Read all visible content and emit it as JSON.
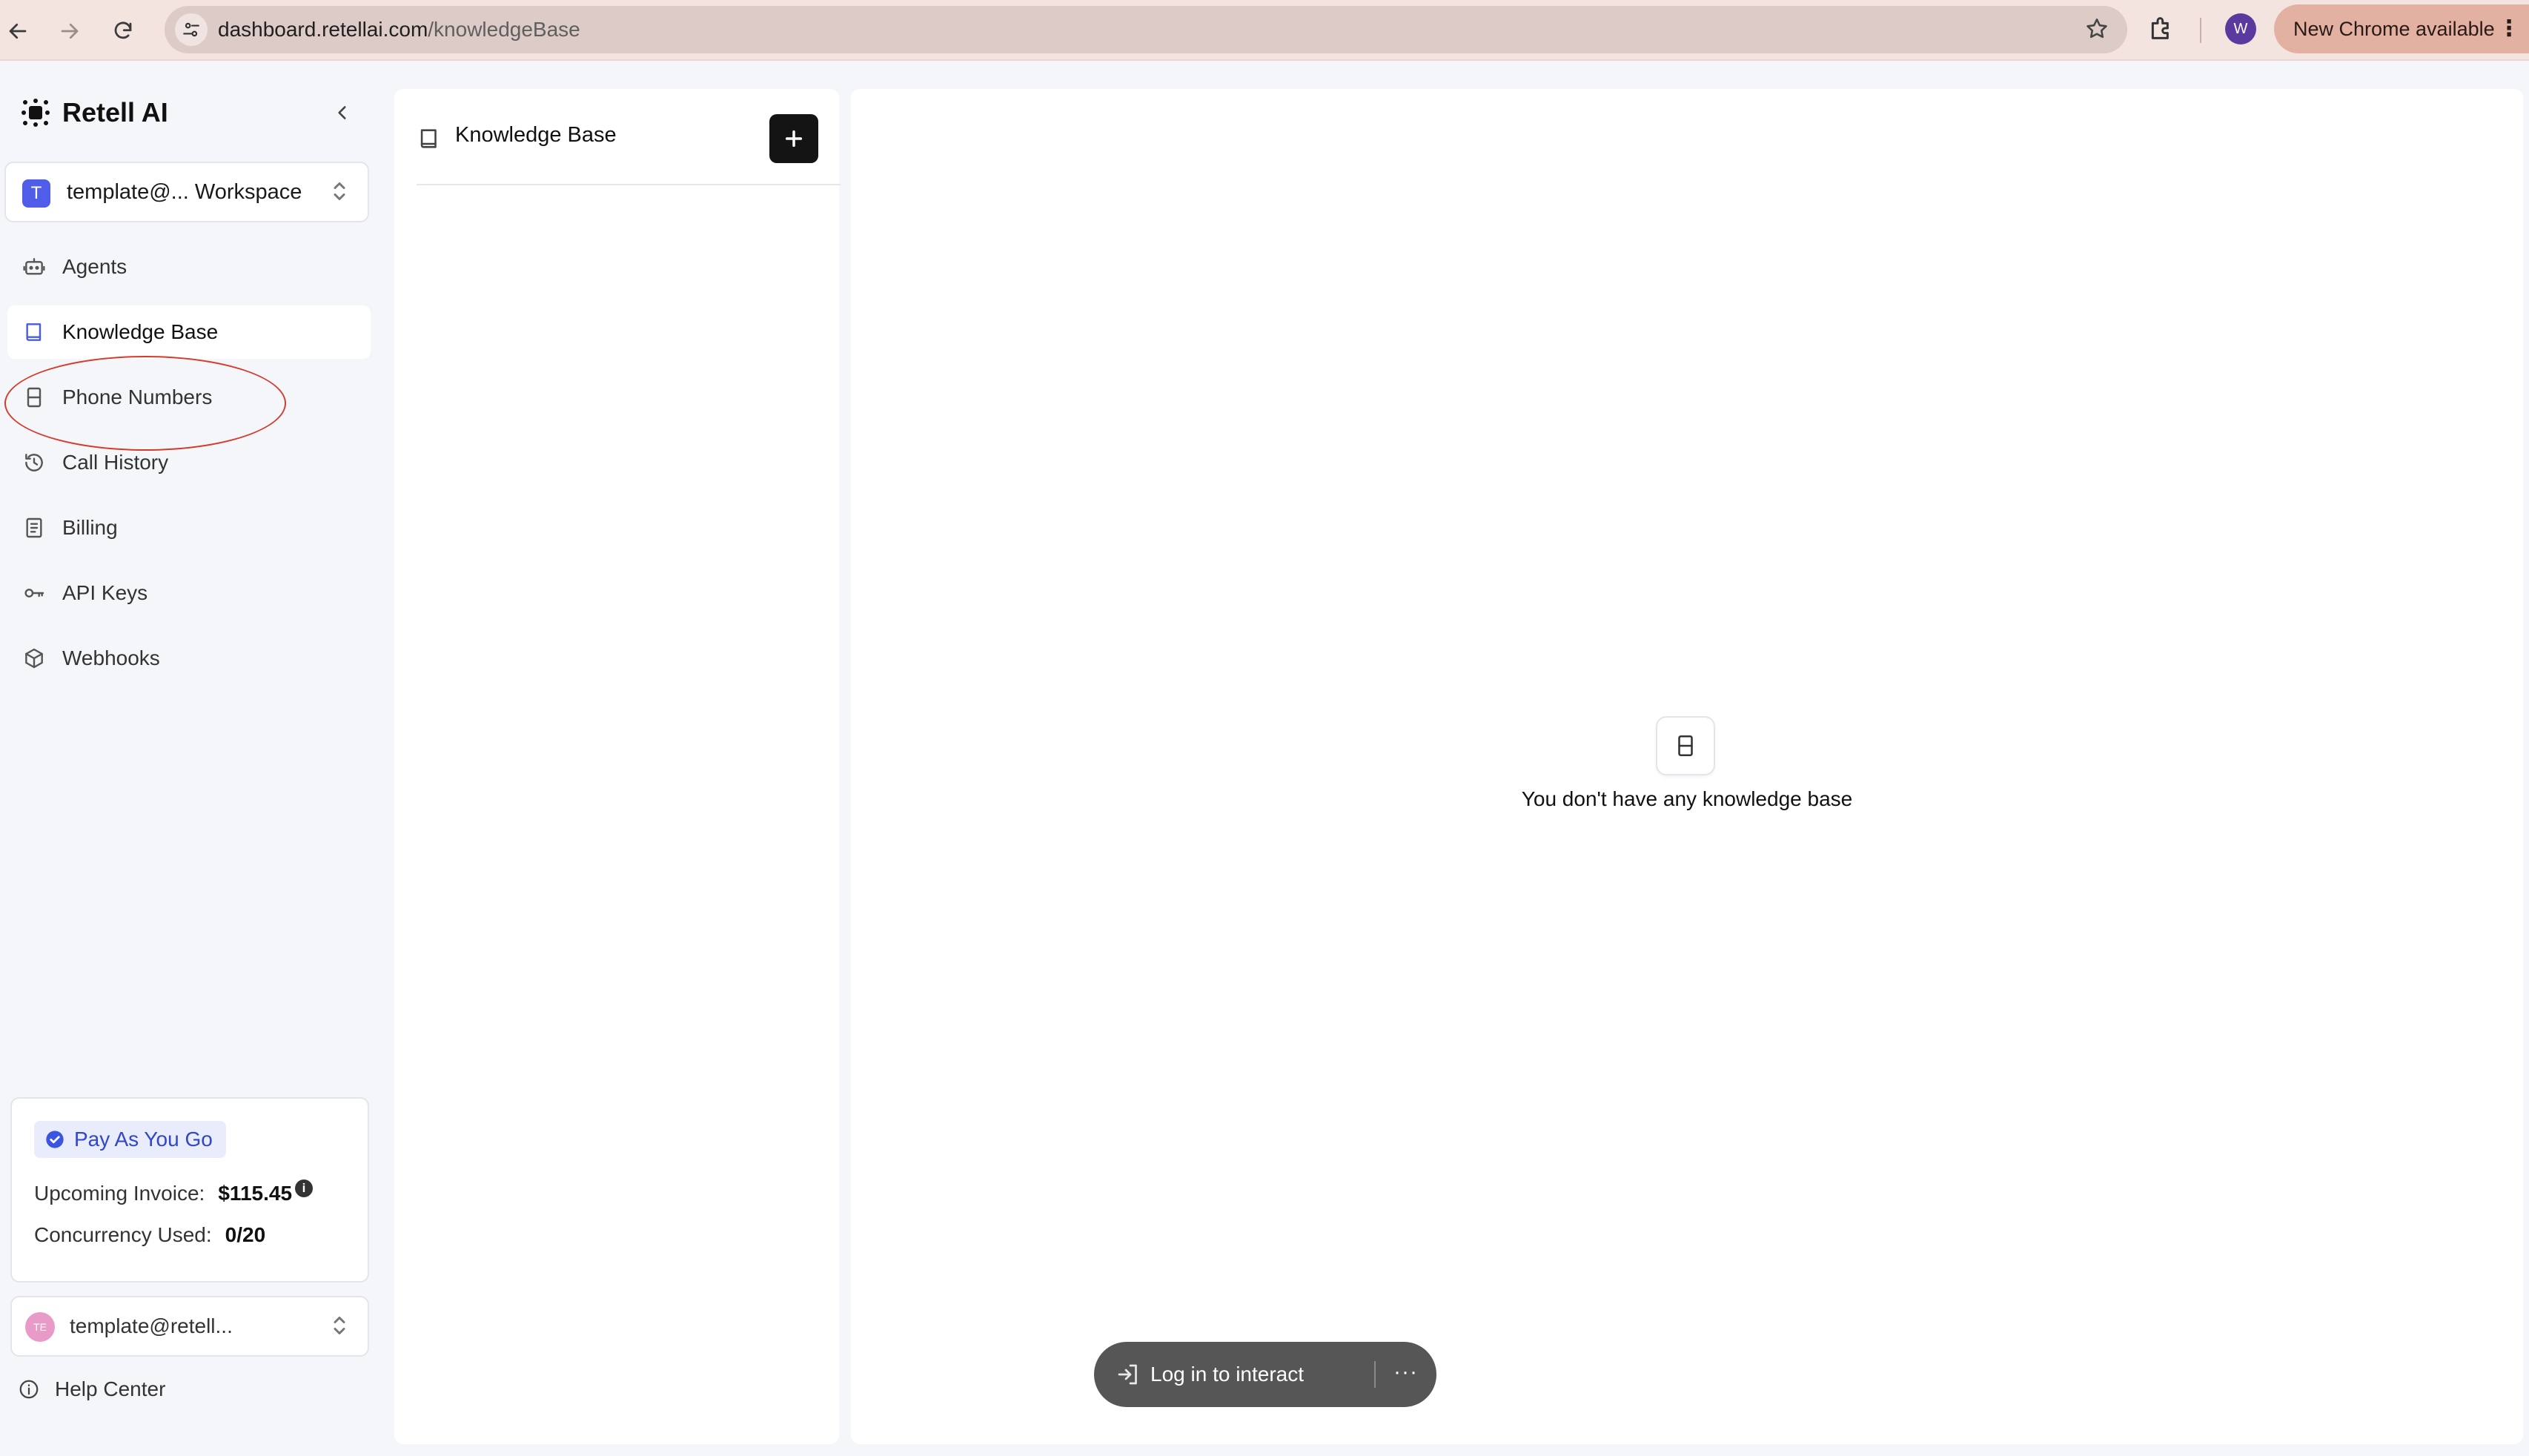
{
  "browser": {
    "url_host": "dashboard.retellai.com",
    "url_path": "/knowledgeBase",
    "profile_initial": "W",
    "update_label": "New Chrome available"
  },
  "sidebar": {
    "brand": "Retell AI",
    "workspace": {
      "initial": "T",
      "name": "template@... Workspace"
    },
    "items": [
      {
        "label": "Agents",
        "icon": "robot-icon"
      },
      {
        "label": "Knowledge Base",
        "icon": "book-icon",
        "active": true
      },
      {
        "label": "Phone Numbers",
        "icon": "phone-icon"
      },
      {
        "label": "Call History",
        "icon": "history-icon"
      },
      {
        "label": "Billing",
        "icon": "receipt-icon"
      },
      {
        "label": "API Keys",
        "icon": "key-icon"
      },
      {
        "label": "Webhooks",
        "icon": "webhook-icon"
      }
    ],
    "plan": {
      "badge": "Pay As You Go",
      "invoice_label": "Upcoming Invoice:",
      "invoice_value": "$115.45",
      "concurrency_label": "Concurrency Used:",
      "concurrency_value": "0/20"
    },
    "user": {
      "initials": "TE",
      "email": "template@retell..."
    },
    "help": "Help Center"
  },
  "kb_panel": {
    "title": "Knowledge Base"
  },
  "main": {
    "empty_text": "You don't have any knowledge base",
    "login_label": "Log in to interact",
    "more_label": "···"
  },
  "colors": {
    "accent": "#4a5ae8",
    "highlight_ring": "#d43b2c",
    "chrome_bg": "#f3e4df"
  }
}
